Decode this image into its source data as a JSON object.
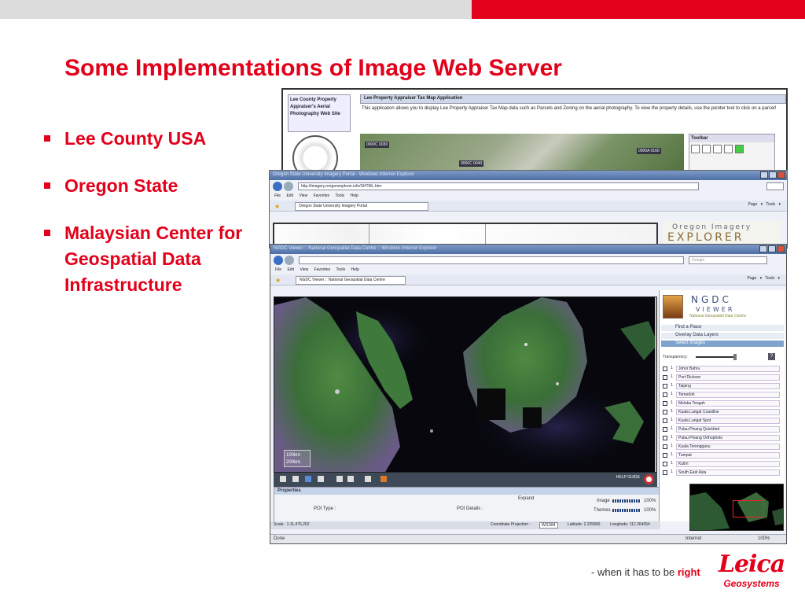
{
  "slide": {
    "title": "Some Implementations of Image Web Server",
    "bullets": [
      "Lee County USA",
      "Oregon State",
      "Malaysian Center for Geospatial Data Infrastructure"
    ],
    "tagline_prefix": "- when it has to be ",
    "tagline_emphasis": "right",
    "logo_word": "Leica",
    "logo_sub": "Geosystems",
    "accent_color": "#e2001a"
  },
  "lee": {
    "nav_text": "Lee County Property Appraiser's Aerial Photography Web Site",
    "app_title": "Lee Property Appraiser Tax Map Application",
    "description": "This application allows you to display Lee Property Appraiser Tax Map data such as Parcels and Zoning on the aerial photography. To view the property details, use the pointer tool to click on a parcel!",
    "map_labels": [
      "0000C 0030",
      "0000C 0040",
      "0000A 0160"
    ],
    "toolbar_title": "Toolbar"
  },
  "oregon": {
    "window_title": "Oregon State University Imagery Portal - Windows Internet Explorer",
    "address": "http://imagery.oregonexplorer.info/SHTML.htm",
    "menu": "File  Edit  View  Favorites  Tools  Help",
    "tab": "Oregon State University Imagery Portal",
    "commands": "Page ▾  Tools ▾",
    "brand_line1": "Oregon Imagery",
    "brand_line2": "EXPLORER"
  },
  "ngdc": {
    "window_title": "NGDC Viewer :: National Geospatial Data Centre :: Windows Internet Explorer",
    "search_placeholder": "Google",
    "menu": "File  Edit  View  Favorites  Tools  Help",
    "tab": "NGDC Viewer :: National Geospatial Data Centre",
    "commands": "Page ▾  Tools ▾",
    "logo_name": "NGDC",
    "logo_viewer": "VIEWER",
    "logo_sub": "National Geospatial Data Centre",
    "menu_items": [
      "Find a Place",
      "Overlay Data Layers",
      "Select Images"
    ],
    "transparency_label": "Transparency:",
    "help_q": "?",
    "places": [
      "Johor Bahru",
      "Port Dickson",
      "Taiping",
      "Temerloh",
      "Melaka Tengah",
      "Kuala Langat Coastline",
      "Kuala Langat Spot",
      "Pulau Pinang Quickbird",
      "Pulau Pinang Orthophoto",
      "Kuala Terengganu",
      "Tumpat",
      "Kulim",
      "South East Asia"
    ],
    "place_num": "1",
    "scale_lines": [
      "100km",
      "200km"
    ],
    "help_label": "HELP GUIDE",
    "properties_title": "Properties",
    "expand_label": "Expand",
    "poi_type_label": "POI Type :",
    "poi_details_label": "POI Details :",
    "image_label": "Image",
    "image_pct": "100%",
    "themes_label": "Themes",
    "themes_pct": "100%",
    "scale_text": "Scale : 1:11,476,252",
    "projection_label": "Coordinate Projection :",
    "projection_value": "WGS84",
    "latitude_text": "Latitude: 2.235800",
    "longitude_text": "Longitude: 112.264054",
    "ie_zone": "Internet",
    "ie_zoom": "100%",
    "done_text": "Done"
  }
}
